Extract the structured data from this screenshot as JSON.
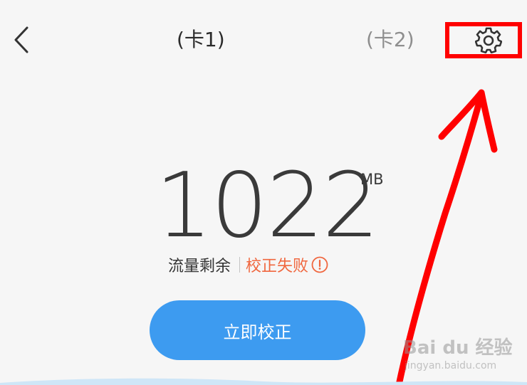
{
  "header": {
    "back_icon": "chevron-left-icon",
    "tabs": [
      {
        "label": "(卡1)",
        "active": true
      },
      {
        "label": "(卡2)",
        "active": false
      }
    ],
    "settings_icon": "gear-icon"
  },
  "usage": {
    "value": "1022",
    "unit": "MB",
    "label": "流量剩余",
    "status": "校正失败",
    "status_icon": "exclamation-circle-icon"
  },
  "actions": {
    "calibrate_label": "立即校正"
  },
  "watermark": {
    "brand": "Bai du 经验",
    "url": "jingyan.baidu.com"
  },
  "colors": {
    "background": "#f6f6f6",
    "primary_button": "#3d9bf0",
    "error": "#f0673f",
    "annotation": "#ff0000",
    "text_primary": "#2b2b2b",
    "text_inactive": "#8e8e8e"
  }
}
